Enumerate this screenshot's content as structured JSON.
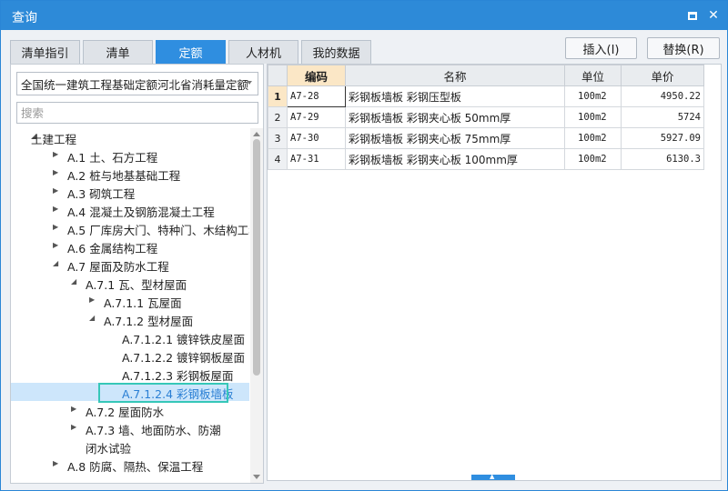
{
  "window": {
    "title": "查询"
  },
  "tabs": [
    {
      "label": "清单指引",
      "active": false
    },
    {
      "label": "清单",
      "active": false
    },
    {
      "label": "定额",
      "active": true
    },
    {
      "label": "人材机",
      "active": false
    },
    {
      "label": "我的数据",
      "active": false
    }
  ],
  "actions": {
    "insert_label": "插入(I)",
    "replace_label": "替换(R)"
  },
  "left": {
    "quota_select_value": "全国统一建筑工程基础定额河北省消耗量定额",
    "search_placeholder": "搜索",
    "tree": [
      {
        "label": "土建工程",
        "level": 0,
        "state": "expanded"
      },
      {
        "label": "A.1 土、石方工程",
        "level": 1,
        "state": "collapsed"
      },
      {
        "label": "A.2 桩与地基基础工程",
        "level": 1,
        "state": "collapsed"
      },
      {
        "label": "A.3 砌筑工程",
        "level": 1,
        "state": "collapsed"
      },
      {
        "label": "A.4 混凝土及钢筋混凝土工程",
        "level": 1,
        "state": "collapsed"
      },
      {
        "label": "A.5 厂库房大门、特种门、木结构工程",
        "level": 1,
        "state": "collapsed"
      },
      {
        "label": "A.6 金属结构工程",
        "level": 1,
        "state": "collapsed"
      },
      {
        "label": "A.7 屋面及防水工程",
        "level": 1,
        "state": "expanded"
      },
      {
        "label": "A.7.1 瓦、型材屋面",
        "level": 2,
        "state": "expanded"
      },
      {
        "label": "A.7.1.1 瓦屋面",
        "level": 3,
        "state": "collapsed"
      },
      {
        "label": "A.7.1.2 型材屋面",
        "level": 3,
        "state": "expanded"
      },
      {
        "label": "A.7.1.2.1 镀锌铁皮屋面",
        "level": 4,
        "state": "leaf"
      },
      {
        "label": "A.7.1.2.2 镀锌钢板屋面",
        "level": 4,
        "state": "leaf"
      },
      {
        "label": "A.7.1.2.3 彩钢板屋面",
        "level": 4,
        "state": "leaf"
      },
      {
        "label": "A.7.1.2.4 彩钢板墙板",
        "level": 4,
        "state": "leaf",
        "selected": true
      },
      {
        "label": "A.7.2 屋面防水",
        "level": 2,
        "state": "collapsed"
      },
      {
        "label": "A.7.3 墙、地面防水、防潮",
        "level": 2,
        "state": "collapsed"
      },
      {
        "label": "闭水试验",
        "level": 2,
        "state": "leaf"
      },
      {
        "label": "A.8 防腐、隔热、保温工程",
        "level": 1,
        "state": "collapsed"
      }
    ]
  },
  "grid": {
    "headers": {
      "code": "编码",
      "name": "名称",
      "unit": "单位",
      "price": "单价"
    },
    "rows": [
      {
        "num": "1",
        "code": "A7-28",
        "name": "彩钢板墙板 彩钢压型板",
        "unit": "100m2",
        "price": "4950.22"
      },
      {
        "num": "2",
        "code": "A7-29",
        "name": "彩钢板墙板 彩钢夹心板 50mm厚",
        "unit": "100m2",
        "price": "5724"
      },
      {
        "num": "3",
        "code": "A7-30",
        "name": "彩钢板墙板 彩钢夹心板 75mm厚",
        "unit": "100m2",
        "price": "5927.09"
      },
      {
        "num": "4",
        "code": "A7-31",
        "name": "彩钢板墙板 彩钢夹心板 100mm厚",
        "unit": "100m2",
        "price": "6130.3"
      }
    ]
  },
  "colors": {
    "accent": "#2f8ee0",
    "titlebar": "#2d8ad8",
    "selection_outline": "#36c7b8",
    "header_active": "#fbe7c6"
  }
}
